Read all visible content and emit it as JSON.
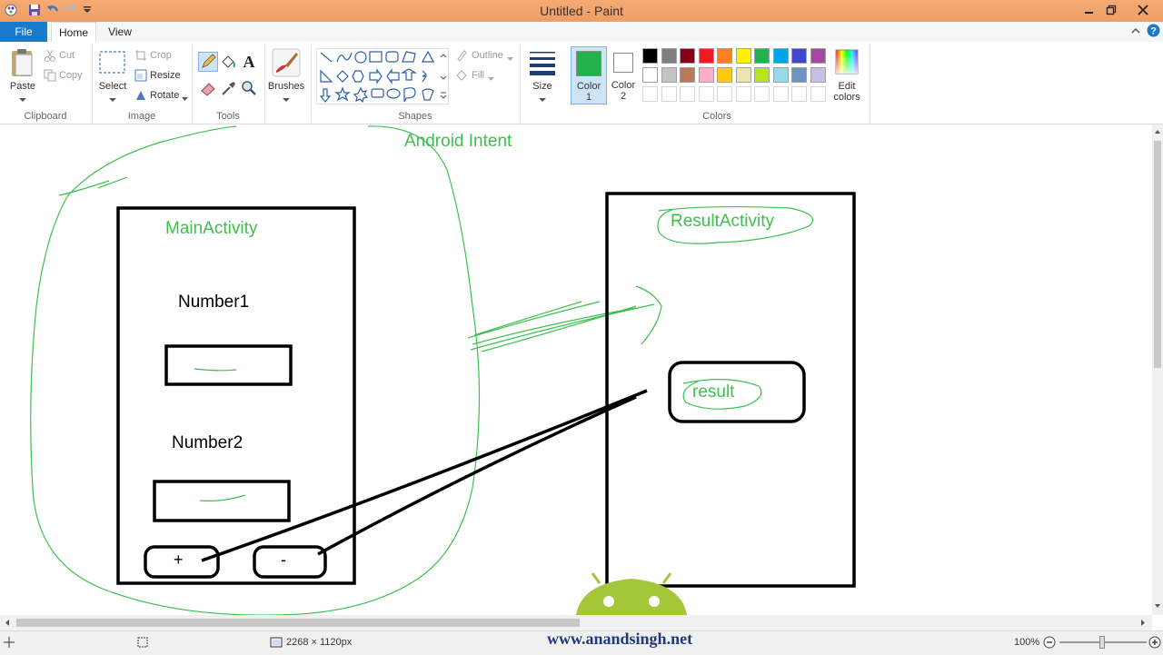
{
  "window": {
    "title": "Untitled - Paint"
  },
  "tabs": {
    "file": "File",
    "home": "Home",
    "view": "View"
  },
  "clipboard": {
    "paste": "Paste",
    "cut": "Cut",
    "copy": "Copy",
    "group": "Clipboard"
  },
  "image": {
    "select": "Select",
    "crop": "Crop",
    "resize": "Resize",
    "rotate": "Rotate",
    "group": "Image"
  },
  "tools": {
    "group": "Tools"
  },
  "brushes": {
    "label": "Brushes"
  },
  "shapes": {
    "outline": "Outline",
    "fill": "Fill",
    "group": "Shapes"
  },
  "size": {
    "label": "Size"
  },
  "colors": {
    "color1_label": "Color",
    "color1_num": "1",
    "color2_label": "Color",
    "color2_num": "2",
    "edit_label": "Edit",
    "edit_label2": "colors",
    "group": "Colors",
    "color1": "#22b14c",
    "color2": "#ffffff",
    "palette_row1": [
      "#000000",
      "#7f7f7f",
      "#880015",
      "#ed1c24",
      "#ff7f27",
      "#fff200",
      "#22b14c",
      "#00a2e8",
      "#3f48cc",
      "#a349a4"
    ],
    "palette_row2": [
      "#ffffff",
      "#c3c3c3",
      "#b97a57",
      "#ffaec9",
      "#ffc90e",
      "#efe4b0",
      "#b5e61d",
      "#99d9ea",
      "#7092be",
      "#c8bfe7"
    ]
  },
  "drawing": {
    "title": "Android Intent",
    "main_activity": "MainActivity",
    "number1": "Number1",
    "number2": "Number2",
    "plus": "+",
    "minus": "-",
    "result_activity": "ResultActivity",
    "result": "result",
    "ink_green": "#3dbf4e"
  },
  "watermark": {
    "text": "www.anandsingh.net"
  },
  "status": {
    "canvas_size": "2268 × 1120px",
    "zoom": "100%"
  }
}
